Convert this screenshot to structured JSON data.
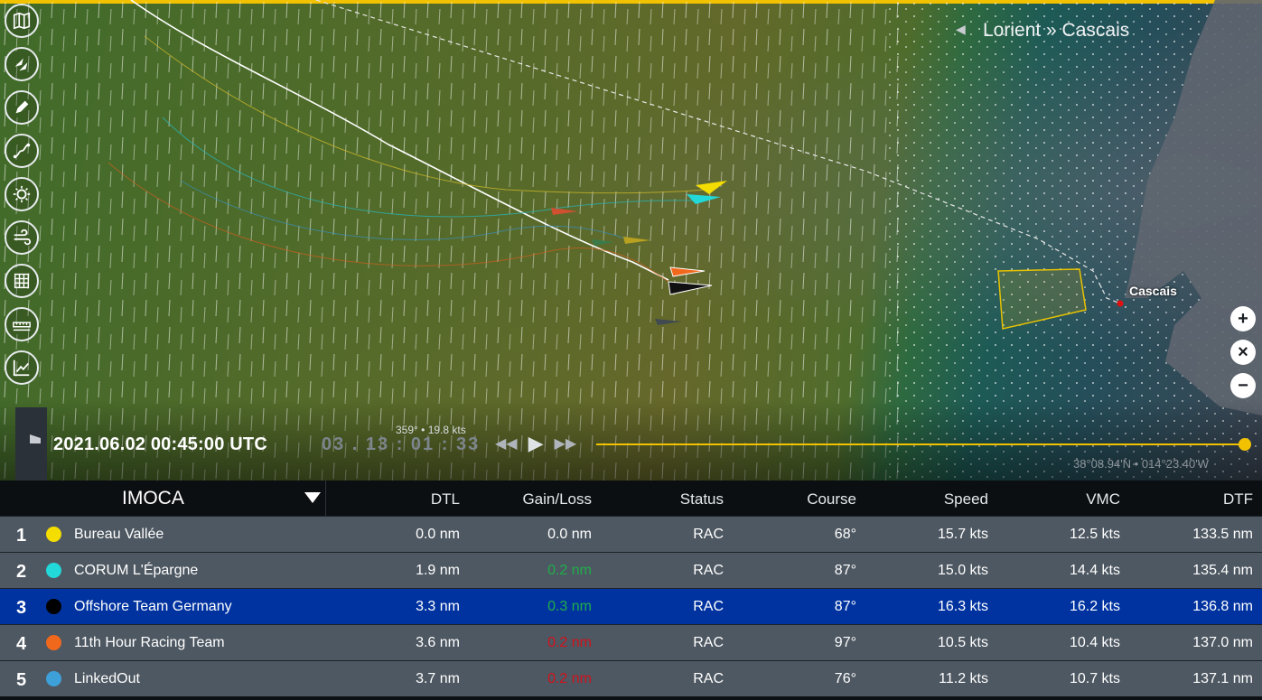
{
  "map": {
    "leg": {
      "title": "Lorient » Cascais"
    },
    "place_label": "Cascais",
    "wind_readout": "359° • 19.8 kts",
    "coordinates": "38°08.94'N • 014°23.40'W",
    "toolbar": [
      {
        "icon": "map-icon"
      },
      {
        "icon": "boats-icon"
      },
      {
        "icon": "pencil-icon"
      },
      {
        "icon": "route-icon"
      },
      {
        "icon": "weather-icon"
      },
      {
        "icon": "wind-icon"
      },
      {
        "icon": "grid-icon"
      },
      {
        "icon": "ruler-icon"
      },
      {
        "icon": "chart-icon"
      }
    ],
    "zoom": {
      "in": "+",
      "reset": "×",
      "out": "−"
    },
    "colors": {
      "accent": "#f2c200",
      "selected_row": "#0033a0"
    }
  },
  "playback": {
    "datetime": "2021.06.02 00:45:00 UTC",
    "elapsed": "03 . 13 : 01 : 33",
    "progress": 1.0
  },
  "table": {
    "class_select": "IMOCA",
    "columns": {
      "dtl": "DTL",
      "gain": "Gain/Loss",
      "status": "Status",
      "course": "Course",
      "speed": "Speed",
      "vmc": "VMC",
      "dtf": "DTF"
    },
    "rows": [
      {
        "rank": "1",
        "color": "#f4dd00",
        "name": "Bureau Vallée",
        "dtl": "0.0 nm",
        "gain": "0.0 nm",
        "gain_type": "zero",
        "status": "RAC",
        "course": "68°",
        "speed": "15.7 kts",
        "vmc": "12.5 kts",
        "dtf": "133.5 nm"
      },
      {
        "rank": "2",
        "color": "#22d8d8",
        "name": "CORUM L'Épargne",
        "dtl": "1.9 nm",
        "gain": "0.2 nm",
        "gain_type": "pos",
        "status": "RAC",
        "course": "87°",
        "speed": "15.0 kts",
        "vmc": "14.4 kts",
        "dtf": "135.4 nm"
      },
      {
        "rank": "3",
        "color": "#000000",
        "name": "Offshore Team Germany",
        "dtl": "3.3 nm",
        "gain": "0.3 nm",
        "gain_type": "pos",
        "status": "RAC",
        "course": "87°",
        "speed": "16.3 kts",
        "vmc": "16.2 kts",
        "dtf": "136.8 nm"
      },
      {
        "rank": "4",
        "color": "#f0681c",
        "name": "11th Hour Racing Team",
        "dtl": "3.6 nm",
        "gain": "0.2 nm",
        "gain_type": "neg",
        "status": "RAC",
        "course": "97°",
        "speed": "10.5 kts",
        "vmc": "10.4 kts",
        "dtf": "137.0 nm"
      },
      {
        "rank": "5",
        "color": "#3ea0d8",
        "name": "LinkedOut",
        "dtl": "3.7 nm",
        "gain": "0.2 nm",
        "gain_type": "neg",
        "status": "RAC",
        "course": "76°",
        "speed": "11.2 kts",
        "vmc": "10.7 kts",
        "dtf": "137.1 nm"
      }
    ]
  }
}
